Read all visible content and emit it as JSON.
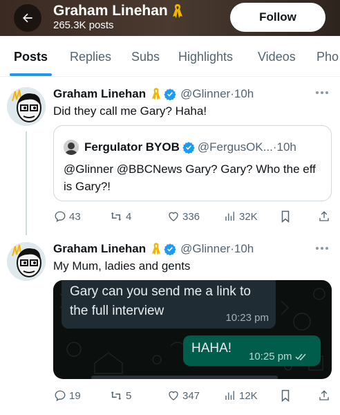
{
  "header": {
    "title": "Graham Linehan",
    "posts_count": "265.3K posts",
    "follow_label": "Follow"
  },
  "tabs": [
    {
      "label": "Posts",
      "active": true
    },
    {
      "label": "Replies"
    },
    {
      "label": "Subs"
    },
    {
      "label": "Highlights"
    },
    {
      "label": "Videos"
    },
    {
      "label": "Pho"
    }
  ],
  "posts": [
    {
      "author": "Graham Linehan",
      "handle": "@Glinner",
      "separator": "·",
      "time": "10h",
      "text": "Did they call me Gary? Haha!",
      "quote": {
        "author": "Fergulator BYOB",
        "handle": "@FergusOK...",
        "separator": "·",
        "time": "10h",
        "text": "@Glinner @BBCNews Gary? Gary? Who the eff is Gary?!"
      },
      "stats": {
        "replies": "43",
        "reposts": "4",
        "likes": "336",
        "views": "32K"
      }
    },
    {
      "author": "Graham Linehan",
      "handle": "@Glinner",
      "separator": "·",
      "time": "10h",
      "text": "My Mum, ladies and gents",
      "media": {
        "incoming_message": "Gary can you send me a link to the full interview",
        "incoming_time": "10:23 pm",
        "outgoing_message": "HAHA!",
        "outgoing_time": "10:25 pm"
      },
      "stats": {
        "replies": "19",
        "reposts": "5",
        "likes": "347",
        "views": "12K"
      }
    }
  ],
  "icons": {
    "back": "arrow-left-icon",
    "ribbon": "ribbon-icon",
    "verified": "verified-badge-icon",
    "more": "more-icon",
    "reply": "reply-icon",
    "repost": "repost-icon",
    "like": "heart-icon",
    "views": "views-icon",
    "bookmark": "bookmark-icon",
    "share": "share-icon"
  },
  "colors": {
    "accent": "#1d9bf0",
    "verified": "#1d9bf0",
    "ribbon": "#f2b600",
    "chat_outgoing": "#005c4b",
    "chat_incoming": "#1f2c33"
  }
}
